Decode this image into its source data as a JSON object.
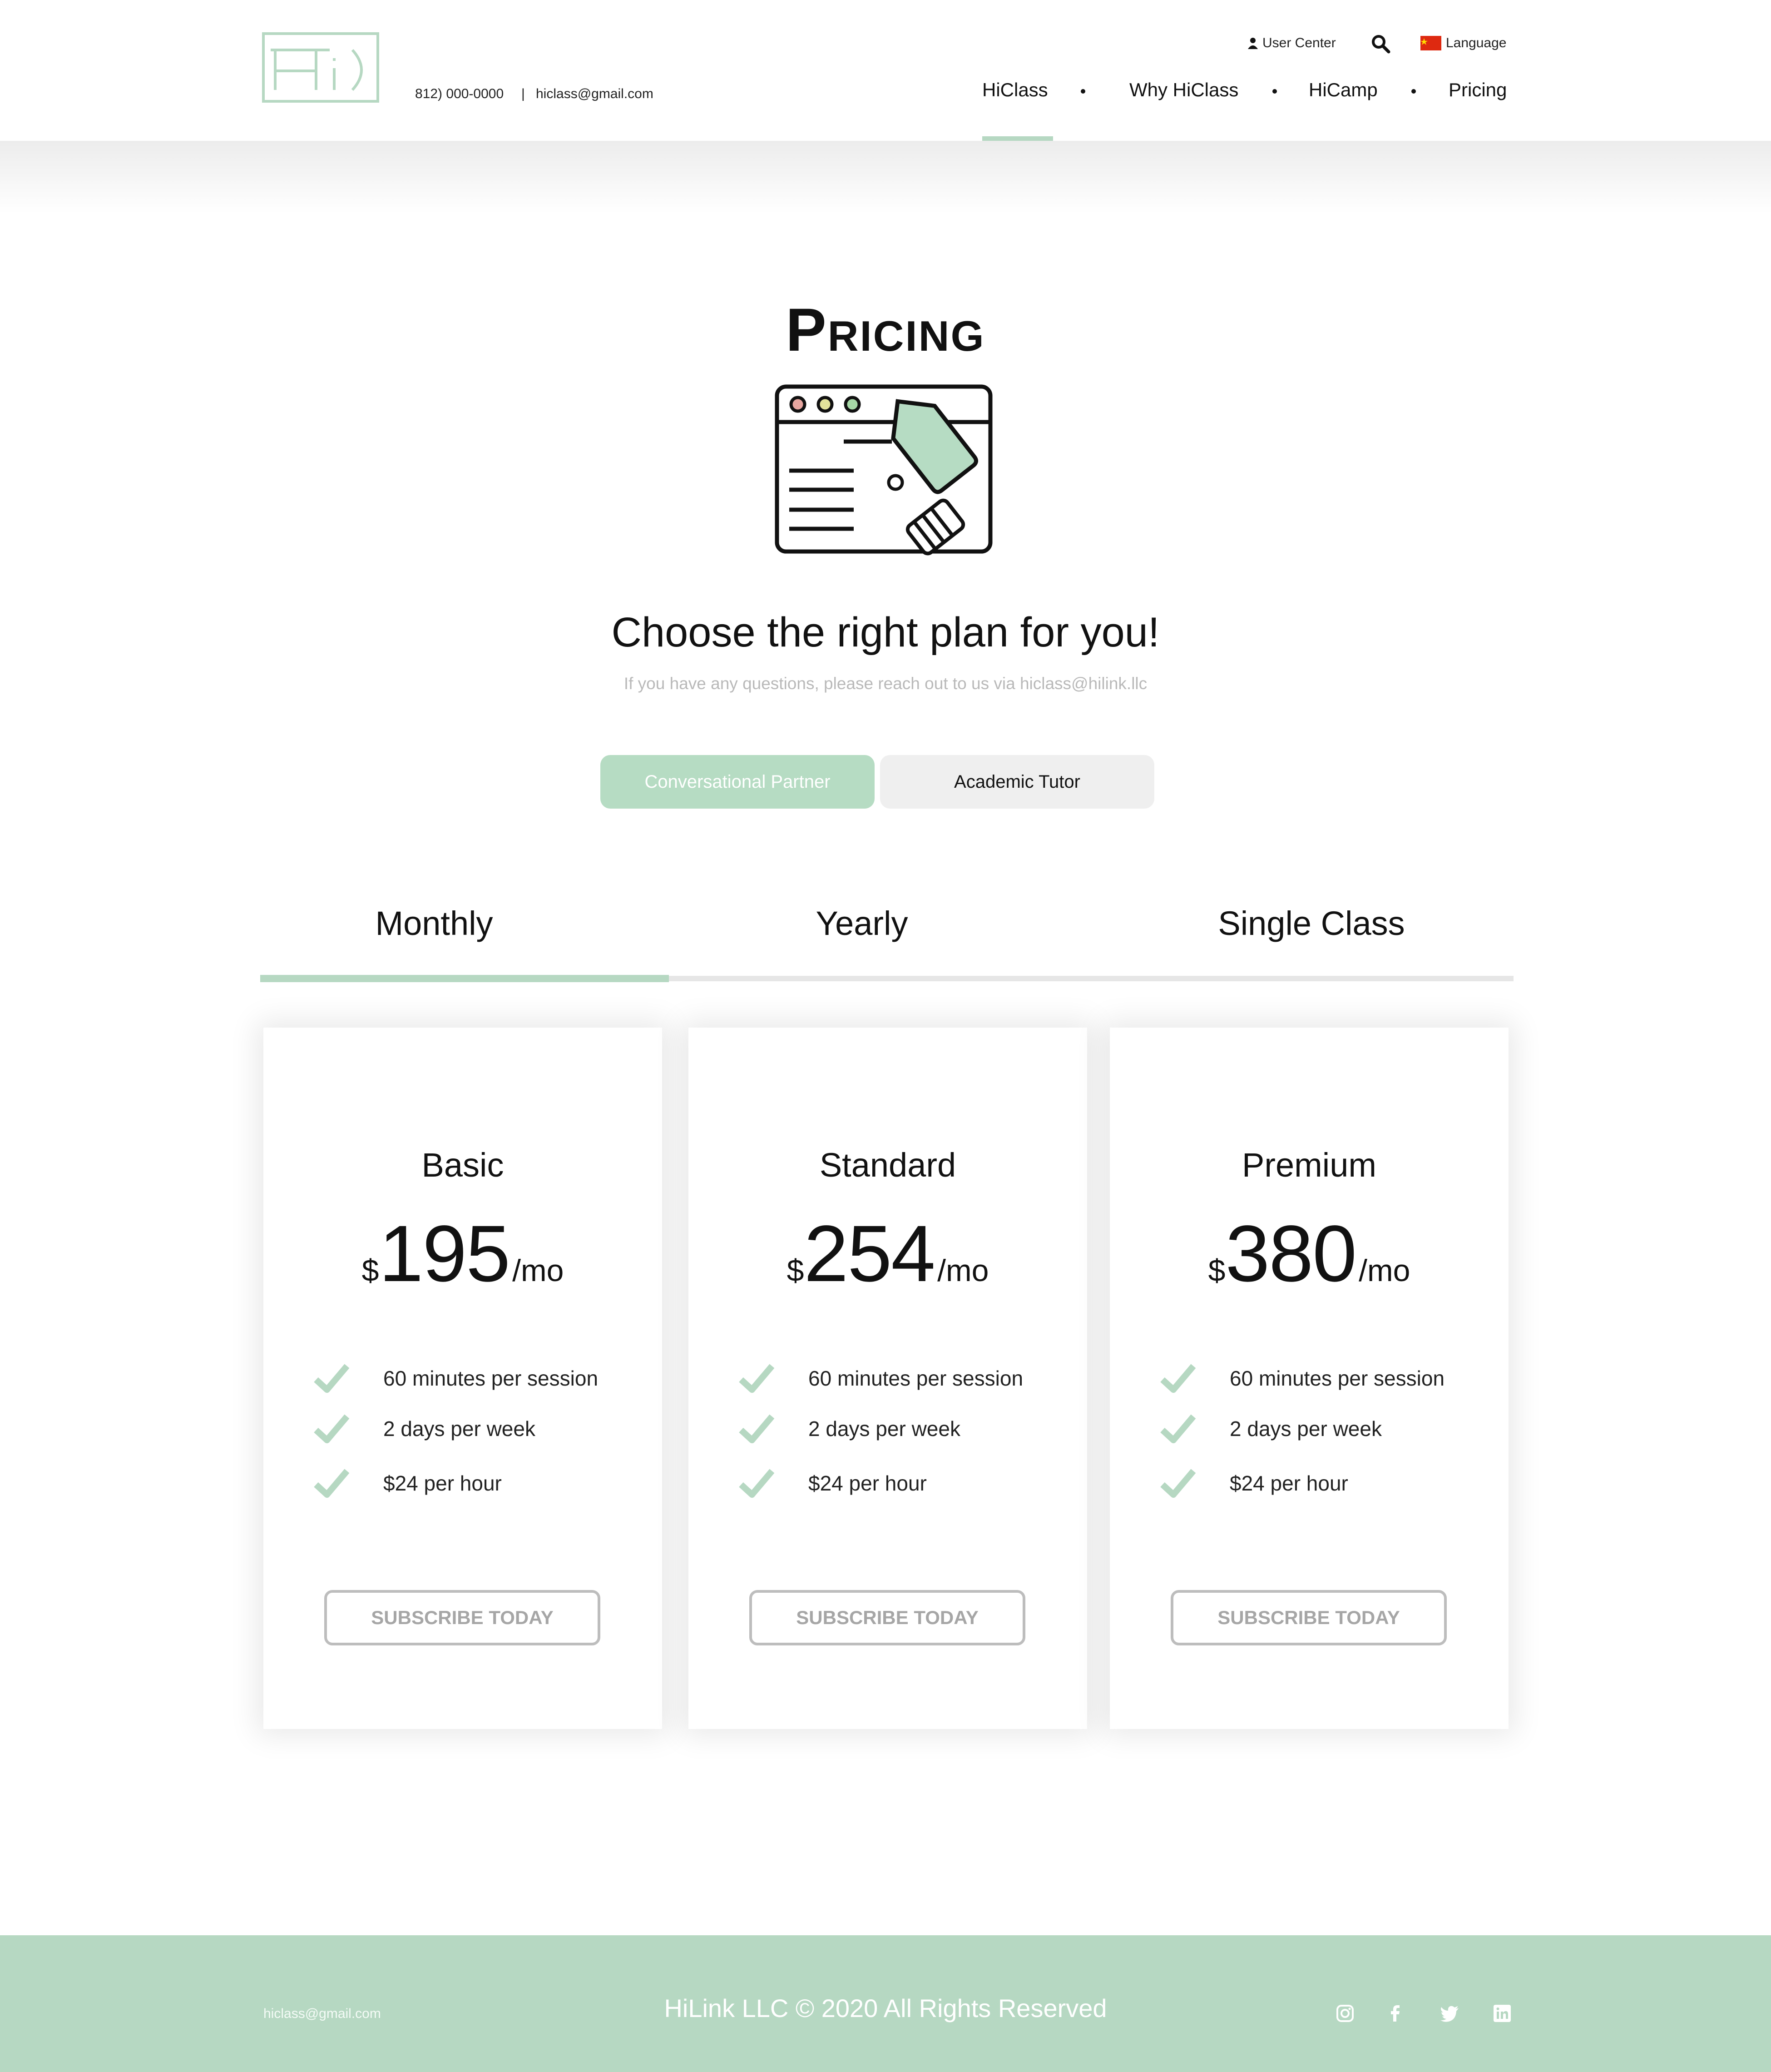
{
  "header": {
    "logo_alt": "Hi)",
    "phone": "812) 000-0000",
    "separator": "|",
    "email": "hiclass@gmail.com",
    "user_center": "User Center",
    "language": "Language",
    "nav": [
      "HiClass",
      "Why HiClass",
      "HiCamp",
      "Pricing"
    ]
  },
  "main": {
    "title": "Pricing",
    "subheading": "Choose the right plan for you!",
    "contact_note": "If you have any questions, please reach out to us via hiclass@hilink.llc",
    "segments": [
      "Conversational Partner",
      "Academic Tutor"
    ],
    "tabs": [
      "Monthly",
      "Yearly",
      "Single Class"
    ],
    "plans": [
      {
        "name": "Basic",
        "currency": "$",
        "price": "195",
        "period": "/mo",
        "features": [
          "60 minutes per session",
          "2 days per week",
          "$24 per hour"
        ],
        "cta": "SUBSCRIBE TODAY"
      },
      {
        "name": "Standard",
        "currency": "$",
        "price": "254",
        "period": "/mo",
        "features": [
          "60 minutes per session",
          "2 days per week",
          "$24 per hour"
        ],
        "cta": "SUBSCRIBE TODAY"
      },
      {
        "name": "Premium",
        "currency": "$",
        "price": "380",
        "period": "/mo",
        "features": [
          "60 minutes per session",
          "2 days per week",
          "$24 per hour"
        ],
        "cta": "SUBSCRIBE TODAY"
      }
    ]
  },
  "footer": {
    "email": "hiclass@gmail.com",
    "copyright": "HiLink LLC © 2020 All Rights Reserved",
    "social": [
      "instagram-icon",
      "facebook-icon",
      "twitter-icon",
      "linkedin-icon"
    ]
  },
  "colors": {
    "accent": "#b6d8c2",
    "segment_active": "#b6dcc3",
    "segment_inactive": "#efefef",
    "muted_text": "#b9b9b9",
    "button_border": "#bdbdbd"
  }
}
